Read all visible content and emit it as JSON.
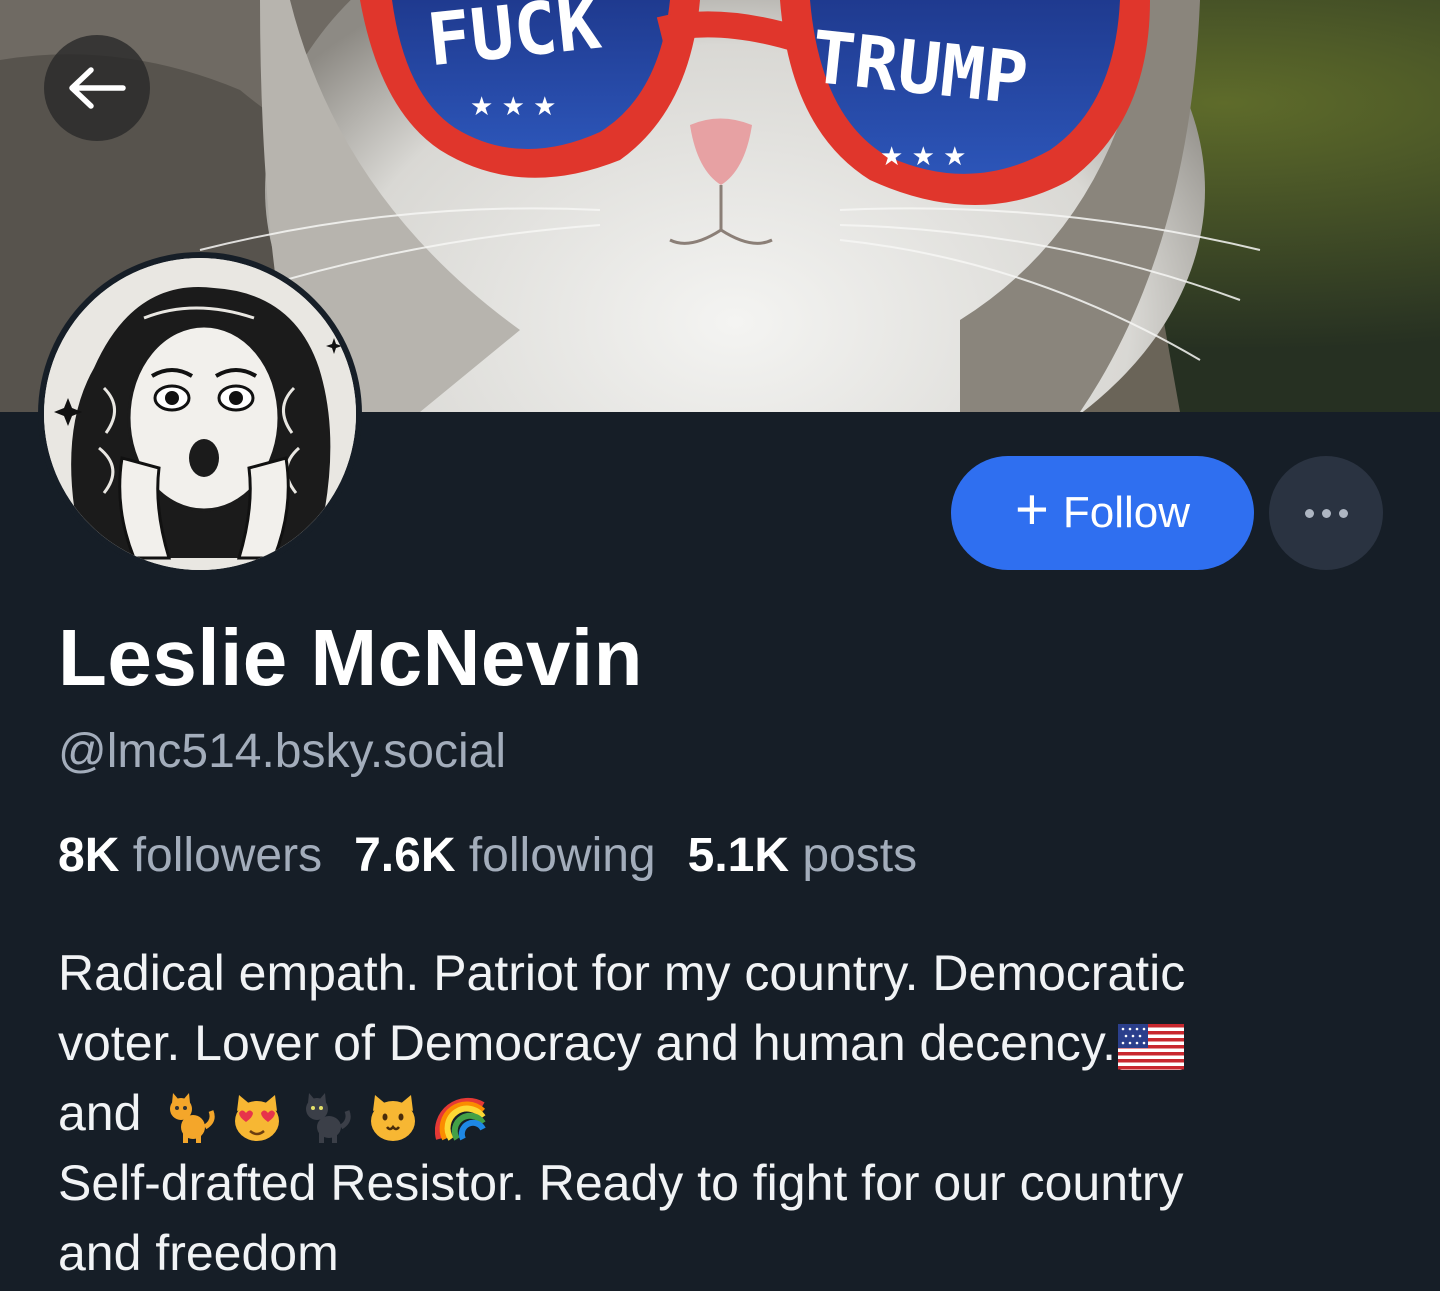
{
  "banner": {
    "sign_left": "FUCK",
    "sign_right": "TRUMP"
  },
  "profile": {
    "display_name": "Leslie McNevin",
    "handle": "@lmc514.bsky.social",
    "follow_button_label": "Follow",
    "stats": [
      {
        "value": "8K",
        "label": "followers"
      },
      {
        "value": "7.6K",
        "label": "following"
      },
      {
        "value": "5.1K",
        "label": "posts"
      }
    ],
    "bio": {
      "line1": "Radical empath. Patriot for my country.  Democratic",
      "line2": "voter. Lover of Democracy and human decency.",
      "line3": "and",
      "line4": "Self-drafted Resistor. Ready to fight for our country",
      "line5": "and freedom"
    }
  },
  "icons": {
    "back": "arrow-left-icon",
    "more": "ellipsis-icon",
    "follow": "plus-icon",
    "flag": "us-flag-emoji",
    "emojis": [
      "cat-emoji",
      "heart-eyes-cat-emoji",
      "black-cat-emoji",
      "cat-face-emoji",
      "rainbow-emoji"
    ]
  },
  "colors": {
    "background": "#161e27",
    "accent": "#2f6ff0",
    "muted_text": "#a3adbb"
  }
}
